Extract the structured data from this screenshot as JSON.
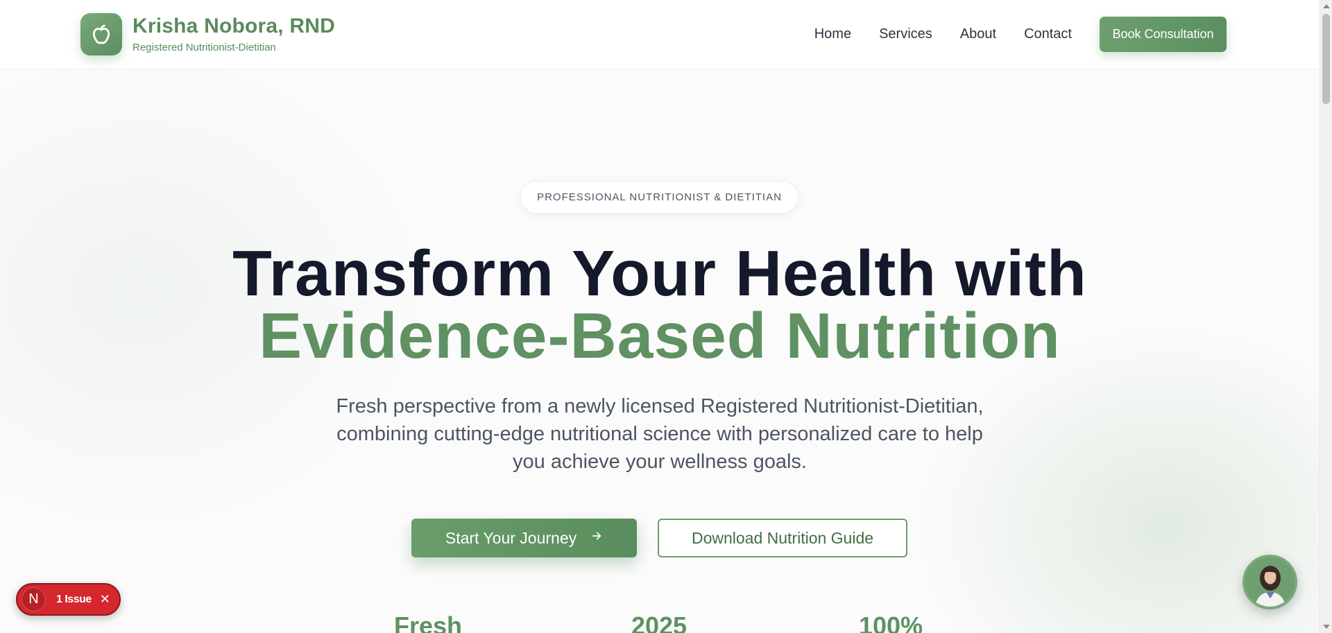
{
  "header": {
    "brand_name": "Krisha Nobora, RND",
    "brand_subtitle": "Registered Nutritionist-Dietitian",
    "logo_icon": "apple-icon",
    "nav": [
      {
        "label": "Home"
      },
      {
        "label": "Services"
      },
      {
        "label": "About"
      },
      {
        "label": "Contact"
      }
    ],
    "cta_label": "Book Consultation"
  },
  "hero": {
    "eyebrow": "PROFESSIONAL NUTRITIONIST & DIETITIAN",
    "headline_line1": "Transform Your Health with",
    "headline_line2": "Evidence-Based Nutrition",
    "lead": "Fresh perspective from a newly licensed Registered Nutritionist-Dietitian, combining cutting-edge nutritional science with personalized care to help you achieve your wellness goals.",
    "primary_button": "Start Your Journey",
    "primary_button_icon": "arrow-right-icon",
    "secondary_button": "Download Nutrition Guide",
    "stats": [
      {
        "value": "Fresh"
      },
      {
        "value": "2025"
      },
      {
        "value": "100%"
      }
    ]
  },
  "widgets": {
    "issue_letter": "N",
    "issue_label": "1 Issue",
    "issue_close": "✕",
    "chat_avatar_icon": "nutritionist-avatar-icon"
  },
  "colors": {
    "brand_green": "#5f9162",
    "headline_dark": "#141a2b",
    "issue_red": "#d6262e"
  }
}
